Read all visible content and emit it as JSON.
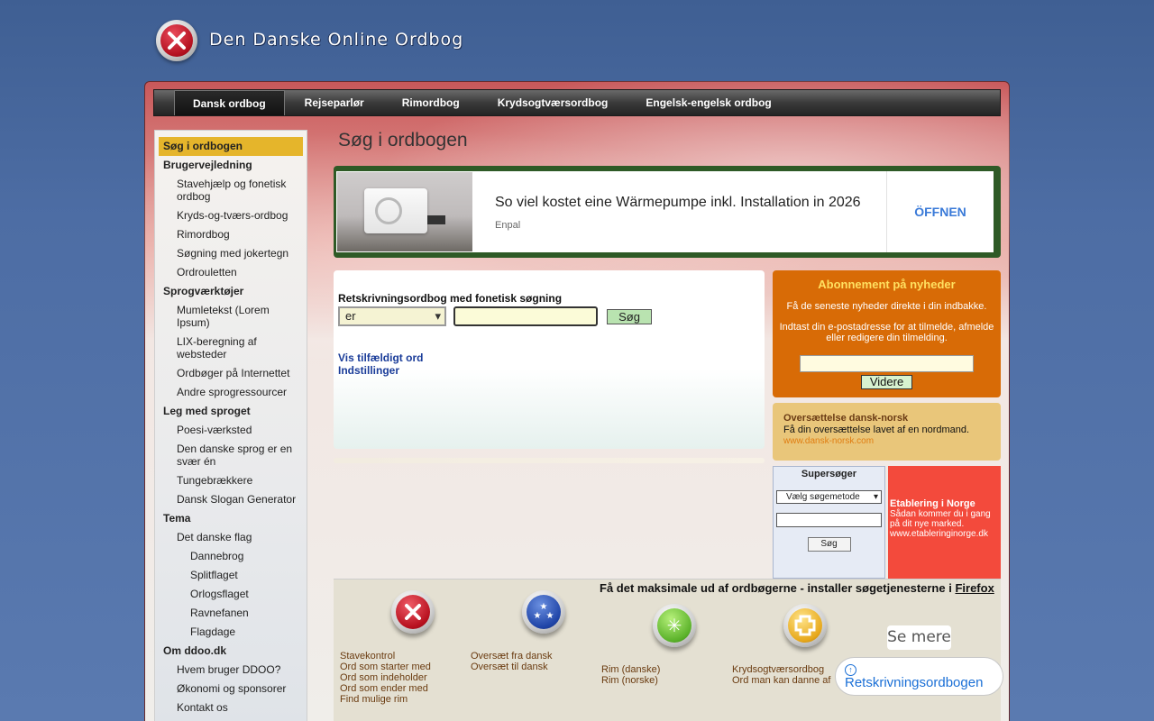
{
  "header": {
    "site_title": "Den Danske Online Ordbog"
  },
  "nav": {
    "tabs": [
      {
        "label": "Dansk ordbog",
        "active": true
      },
      {
        "label": "Rejseparlør",
        "active": false
      },
      {
        "label": "Rimordbog",
        "active": false
      },
      {
        "label": "Krydsogtværsordbog",
        "active": false
      },
      {
        "label": "Engelsk-engelsk ordbog",
        "active": false
      }
    ]
  },
  "sidebar": {
    "items": [
      {
        "label": "Søg i ordbogen",
        "level": 0,
        "active": true
      },
      {
        "label": "Brugervejledning",
        "level": 0
      },
      {
        "label": "Stavehjælp og fonetisk ordbog",
        "level": 1
      },
      {
        "label": "Kryds-og-tværs-ordbog",
        "level": 1
      },
      {
        "label": "Rimordbog",
        "level": 1
      },
      {
        "label": "Søgning med jokertegn",
        "level": 1
      },
      {
        "label": "Ordrouletten",
        "level": 1
      },
      {
        "label": "Sprogværktøjer",
        "level": 0
      },
      {
        "label": "Mumletekst (Lorem Ipsum)",
        "level": 1
      },
      {
        "label": "LIX-beregning af websteder",
        "level": 1
      },
      {
        "label": "Ordbøger på Internettet",
        "level": 1
      },
      {
        "label": "Andre sprogressourcer",
        "level": 1
      },
      {
        "label": "Leg med sproget",
        "level": 0
      },
      {
        "label": "Poesi-værksted",
        "level": 1
      },
      {
        "label": "Den danske sprog er en svær én",
        "level": 1
      },
      {
        "label": "Tungebrækkere",
        "level": 1
      },
      {
        "label": "Dansk Slogan Generator",
        "level": 1
      },
      {
        "label": "Tema",
        "level": 0
      },
      {
        "label": "Det danske flag",
        "level": 1
      },
      {
        "label": "Dannebrog",
        "level": 2
      },
      {
        "label": "Splitflaget",
        "level": 2
      },
      {
        "label": "Orlogsflaget",
        "level": 2
      },
      {
        "label": "Ravnefanen",
        "level": 2
      },
      {
        "label": "Flagdage",
        "level": 2
      },
      {
        "label": "Om ddoo.dk",
        "level": 0
      },
      {
        "label": "Hvem bruger DDOO?",
        "level": 1
      },
      {
        "label": "Økonomi og sponsorer",
        "level": 1
      },
      {
        "label": "Kontakt os",
        "level": 1
      }
    ]
  },
  "main": {
    "page_title": "Søg i ordbogen",
    "ad": {
      "headline": "So viel kostet eine Wärmepumpe inkl. Installation in 2026",
      "source": "Enpal",
      "button": "ÖFFNEN"
    },
    "search": {
      "label": "Retskrivningsordbog med fonetisk søgning",
      "select_value": "er",
      "input_value": "",
      "button": "Søg",
      "link_random": "Vis tilfældigt ord",
      "link_settings": "Indstillinger"
    }
  },
  "newsletter": {
    "title": "Abonnement på nyheder",
    "text1": "Få de seneste nyheder direkte i din indbakke.",
    "text2": "Indtast din e-postadresse for at tilmelde, afmelde eller redigere din tilmelding.",
    "email_value": "",
    "button": "Videre"
  },
  "promo": {
    "title": "Oversættelse dansk-norsk",
    "text": "Få din oversættelse lavet af en nordmand.",
    "link": "www.dansk-norsk.com"
  },
  "supersoger": {
    "title": "Supersøger",
    "select_value": "Vælg søgemetode",
    "input_value": "",
    "button": "Søg"
  },
  "norge": {
    "title": "Etablering i Norge",
    "text": "Sådan kommer du i gang på dit nye marked.",
    "link": "www.etableringinorge.dk"
  },
  "bottom": {
    "headline": "Få det maksimale ud af ordbøgerne - installer søgetjenesterne i",
    "headline_link": "Firefox",
    "col1": [
      "Stavekontrol",
      "Ord som starter med",
      "Ord som indeholder",
      "Ord som ender med",
      "Find mulige rim"
    ],
    "col2": [
      "Oversæt fra dansk",
      "Oversæt til dansk"
    ],
    "col3": [
      "Rim (danske)",
      "Rim (norske)"
    ],
    "col4": [
      "Krydsogtværsordbog",
      "Ord man kan danne af"
    ],
    "se_mere": "Se mere",
    "cta": "Retskrivningsordbogen"
  },
  "colors": {
    "accent_active": "#e5b52b",
    "newsletter_bg": "#d86b06",
    "ad_border": "#2e5a26",
    "norge_bg": "#f34a3c",
    "link": "#1a3c99"
  }
}
